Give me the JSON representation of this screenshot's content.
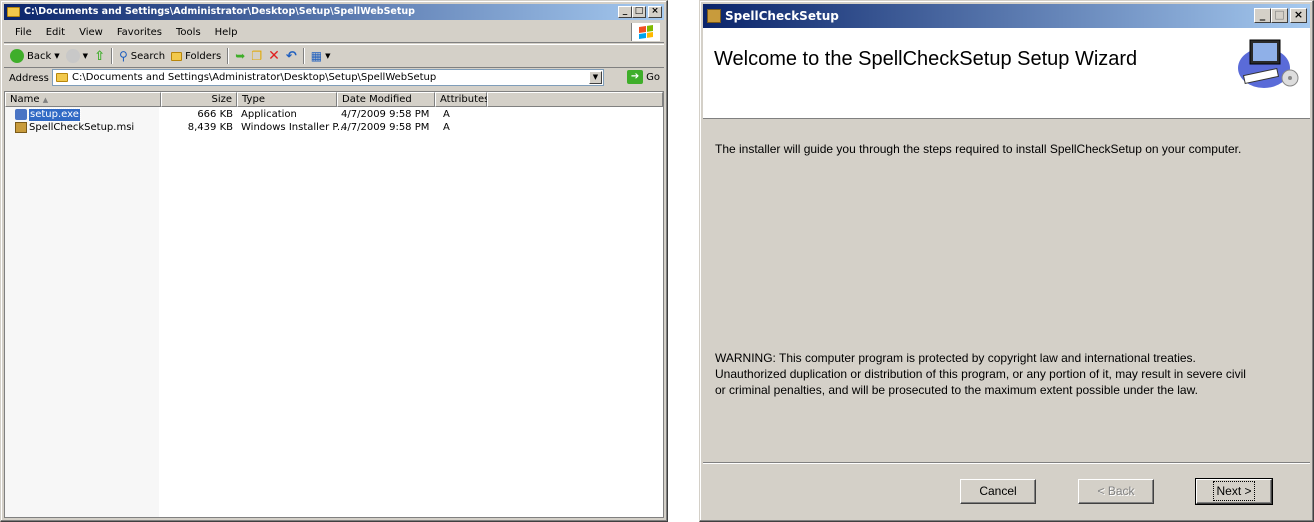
{
  "explorer": {
    "title": "C:\\Documents and Settings\\Administrator\\Desktop\\Setup\\SpellWebSetup",
    "menu": [
      "File",
      "Edit",
      "View",
      "Favorites",
      "Tools",
      "Help"
    ],
    "toolbar": {
      "back": "Back",
      "search": "Search",
      "folders": "Folders"
    },
    "address": {
      "label": "Address",
      "value": "C:\\Documents and Settings\\Administrator\\Desktop\\Setup\\SpellWebSetup",
      "go": "Go"
    },
    "columns": [
      "Name",
      "Size",
      "Type",
      "Date Modified",
      "Attributes"
    ],
    "files": [
      {
        "name": "setup.exe",
        "size": "666 KB",
        "type": "Application",
        "date": "4/7/2009 9:58 PM",
        "attr": "A",
        "icon": "setup-exe-icon"
      },
      {
        "name": "SpellCheckSetup.msi",
        "size": "8,439 KB",
        "type": "Windows Installer P...",
        "date": "4/7/2009 9:58 PM",
        "attr": "A",
        "icon": "msi-package-icon"
      }
    ]
  },
  "installer": {
    "title": "SpellCheckSetup",
    "heading": "Welcome to the SpellCheckSetup Setup Wizard",
    "intro": "The installer will guide you through the steps required to install SpellCheckSetup on your computer.",
    "warning_lines": [
      "WARNING: This computer program is protected by copyright law and international treaties.",
      "Unauthorized duplication or distribution of this program, or any portion of it, may result in severe civil",
      "or criminal penalties, and will be prosecuted to the maximum extent possible under the law."
    ],
    "buttons": {
      "cancel": "Cancel",
      "back": "< Back",
      "next": "Next >"
    }
  }
}
